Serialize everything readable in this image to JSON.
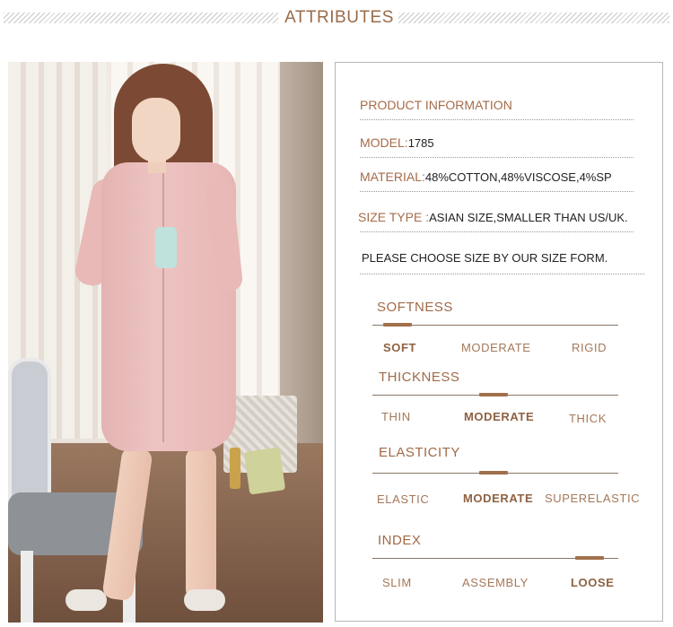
{
  "header": {
    "title": "ATTRIBUTES"
  },
  "product_info": {
    "heading": "PRODUCT INFORMATION",
    "model_label": "MODEL:",
    "model_value": "1785",
    "material_label": "MATERIAL:",
    "material_value": "48%COTTON,48%VISCOSE,4%SP",
    "size_label": "SIZE TYPE :",
    "size_value": "ASIAN SIZE,SMALLER THAN US/UK.",
    "note": "PLEASE CHOOSE SIZE BY OUR SIZE FORM."
  },
  "scales": [
    {
      "title": "SOFTNESS",
      "options": [
        "SOFT",
        "MODERATE",
        "RIGID"
      ],
      "selected": "SOFT"
    },
    {
      "title": "THICKNESS",
      "options": [
        "THIN",
        "MODERATE",
        "THICK"
      ],
      "selected": "MODERATE"
    },
    {
      "title": "ELASTICITY",
      "options": [
        "ELASTIC",
        "MODERATE",
        "SUPERELASTIC"
      ],
      "selected": "MODERATE"
    },
    {
      "title": "INDEX",
      "options": [
        "SLIM",
        "ASSEMBLY",
        "LOOSE"
      ],
      "selected": "LOOSE"
    }
  ],
  "colors": {
    "accent": "#a56b49",
    "marker": "#a0704c",
    "border": "#b6b6b6"
  }
}
